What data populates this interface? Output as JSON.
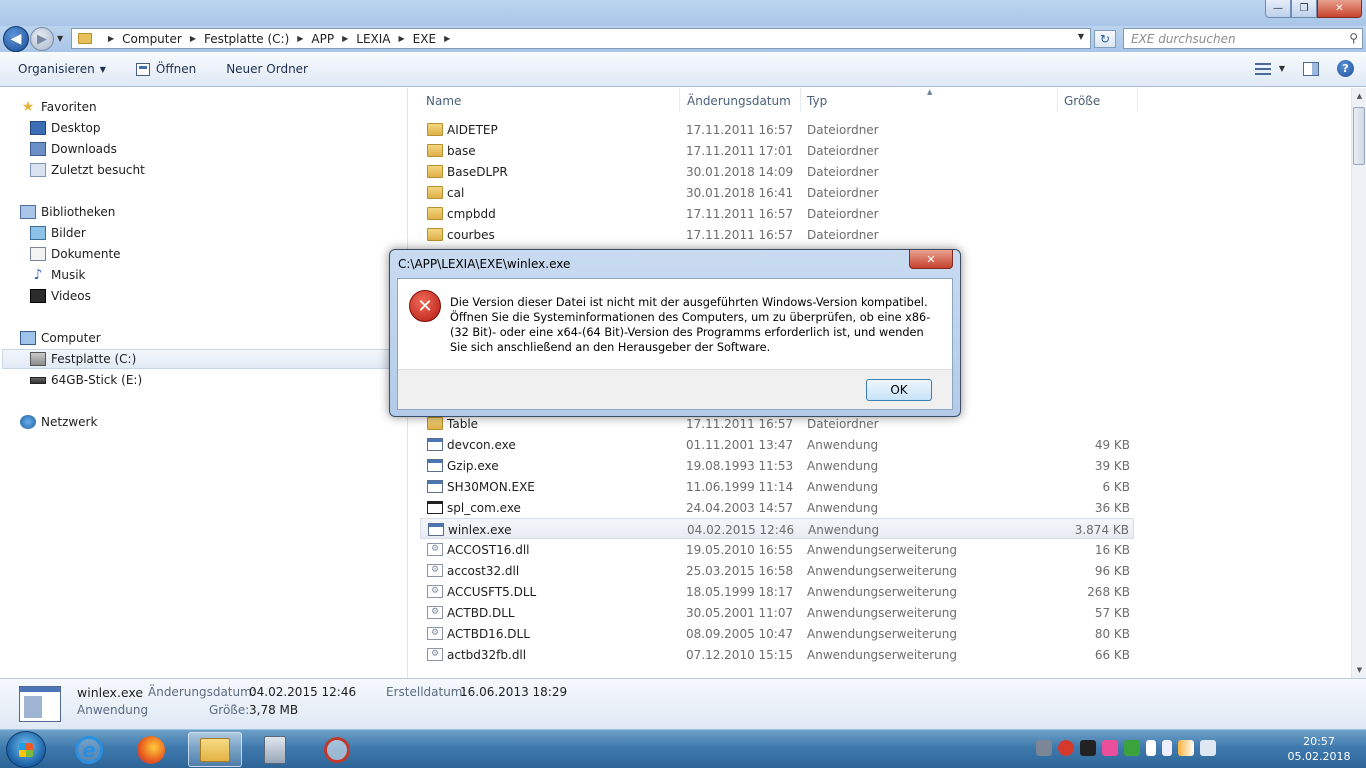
{
  "window": {
    "minimize_glyph": "—",
    "maximize_glyph": "❐",
    "close_glyph": "✕"
  },
  "nav": {
    "back_glyph": "◀",
    "forward_glyph": "▶",
    "breadcrumbs": [
      "Computer",
      "Festplatte (C:)",
      "APP",
      "LEXIA",
      "EXE"
    ],
    "search_placeholder": "EXE durchsuchen"
  },
  "toolbar": {
    "organize_label": "Organisieren",
    "open_label": "Öffnen",
    "new_folder_label": "Neuer Ordner"
  },
  "sidebar": {
    "favorites": "Favoriten",
    "desktop": "Desktop",
    "downloads": "Downloads",
    "recent": "Zuletzt besucht",
    "libraries": "Bibliotheken",
    "pictures": "Bilder",
    "documents": "Dokumente",
    "music": "Musik",
    "videos": "Videos",
    "computer": "Computer",
    "drive_c": "Festplatte (C:)",
    "drive_e": "64GB-Stick (E:)",
    "network": "Netzwerk"
  },
  "columns": {
    "name": "Name",
    "date": "Änderungsdatum",
    "type": "Typ",
    "size": "Größe"
  },
  "files_top": [
    {
      "name": "AIDETEP",
      "date": "17.11.2011 16:57",
      "type": "Dateiordner",
      "size": "",
      "icon": "folder"
    },
    {
      "name": "base",
      "date": "17.11.2011 17:01",
      "type": "Dateiordner",
      "size": "",
      "icon": "folder"
    },
    {
      "name": "BaseDLPR",
      "date": "30.01.2018 14:09",
      "type": "Dateiordner",
      "size": "",
      "icon": "folder"
    },
    {
      "name": "cal",
      "date": "30.01.2018 16:41",
      "type": "Dateiordner",
      "size": "",
      "icon": "folder"
    },
    {
      "name": "cmpbdd",
      "date": "17.11.2011 16:57",
      "type": "Dateiordner",
      "size": "",
      "icon": "folder"
    },
    {
      "name": "courbes",
      "date": "17.11.2011 16:57",
      "type": "Dateiordner",
      "size": "",
      "icon": "folder"
    }
  ],
  "files_bottom": [
    {
      "name": "Table",
      "date": "17.11.2011 16:57",
      "type": "Dateiordner",
      "size": "",
      "icon": "folder"
    },
    {
      "name": "devcon.exe",
      "date": "01.11.2001 13:47",
      "type": "Anwendung",
      "size": "49 KB",
      "icon": "app"
    },
    {
      "name": "Gzip.exe",
      "date": "19.08.1993 11:53",
      "type": "Anwendung",
      "size": "39 KB",
      "icon": "app"
    },
    {
      "name": "SH30MON.EXE",
      "date": "11.06.1999 11:14",
      "type": "Anwendung",
      "size": "6 KB",
      "icon": "app"
    },
    {
      "name": "spl_com.exe",
      "date": "24.04.2003 14:57",
      "type": "Anwendung",
      "size": "36 KB",
      "icon": "win"
    },
    {
      "name": "winlex.exe",
      "date": "04.02.2015 12:46",
      "type": "Anwendung",
      "size": "3.874 KB",
      "icon": "app",
      "selected": true
    },
    {
      "name": "ACCOST16.dll",
      "date": "19.05.2010 16:55",
      "type": "Anwendungserweiterung",
      "size": "16 KB",
      "icon": "dll"
    },
    {
      "name": "accost32.dll",
      "date": "25.03.2015 16:58",
      "type": "Anwendungserweiterung",
      "size": "96 KB",
      "icon": "dll"
    },
    {
      "name": "ACCUSFT5.DLL",
      "date": "18.05.1999 18:17",
      "type": "Anwendungserweiterung",
      "size": "268 KB",
      "icon": "dll"
    },
    {
      "name": "ACTBD.DLL",
      "date": "30.05.2001 11:07",
      "type": "Anwendungserweiterung",
      "size": "57 KB",
      "icon": "dll"
    },
    {
      "name": "ACTBD16.DLL",
      "date": "08.09.2005 10:47",
      "type": "Anwendungserweiterung",
      "size": "80 KB",
      "icon": "dll"
    },
    {
      "name": "actbd32fb.dll",
      "date": "07.12.2010 15:15",
      "type": "Anwendungserweiterung",
      "size": "66 KB",
      "icon": "dll"
    }
  ],
  "details": {
    "filename": "winlex.exe",
    "filetype": "Anwendung",
    "modified_label": "Änderungsdatum:",
    "modified_value": "04.02.2015 12:46",
    "size_label": "Größe:",
    "size_value": "3,78 MB",
    "created_label": "Erstelldatum:",
    "created_value": "16.06.2013 18:29"
  },
  "dialog": {
    "title": "C:\\APP\\LEXIA\\EXE\\winlex.exe",
    "message": "Die Version dieser Datei ist nicht mit der ausgeführten Windows-Version kompatibel. Öffnen Sie die Systeminformationen des Computers, um zu überprüfen, ob eine x86-(32 Bit)- oder eine x64-(64 Bit)-Version des Programms erforderlich ist, und wenden Sie sich anschließend an den Herausgeber der Software.",
    "ok_label": "OK",
    "close_glyph": "✕",
    "error_glyph": "✕"
  },
  "taskbar": {
    "ie_glyph": "e",
    "time": "20:57",
    "date": "05.02.2018"
  }
}
